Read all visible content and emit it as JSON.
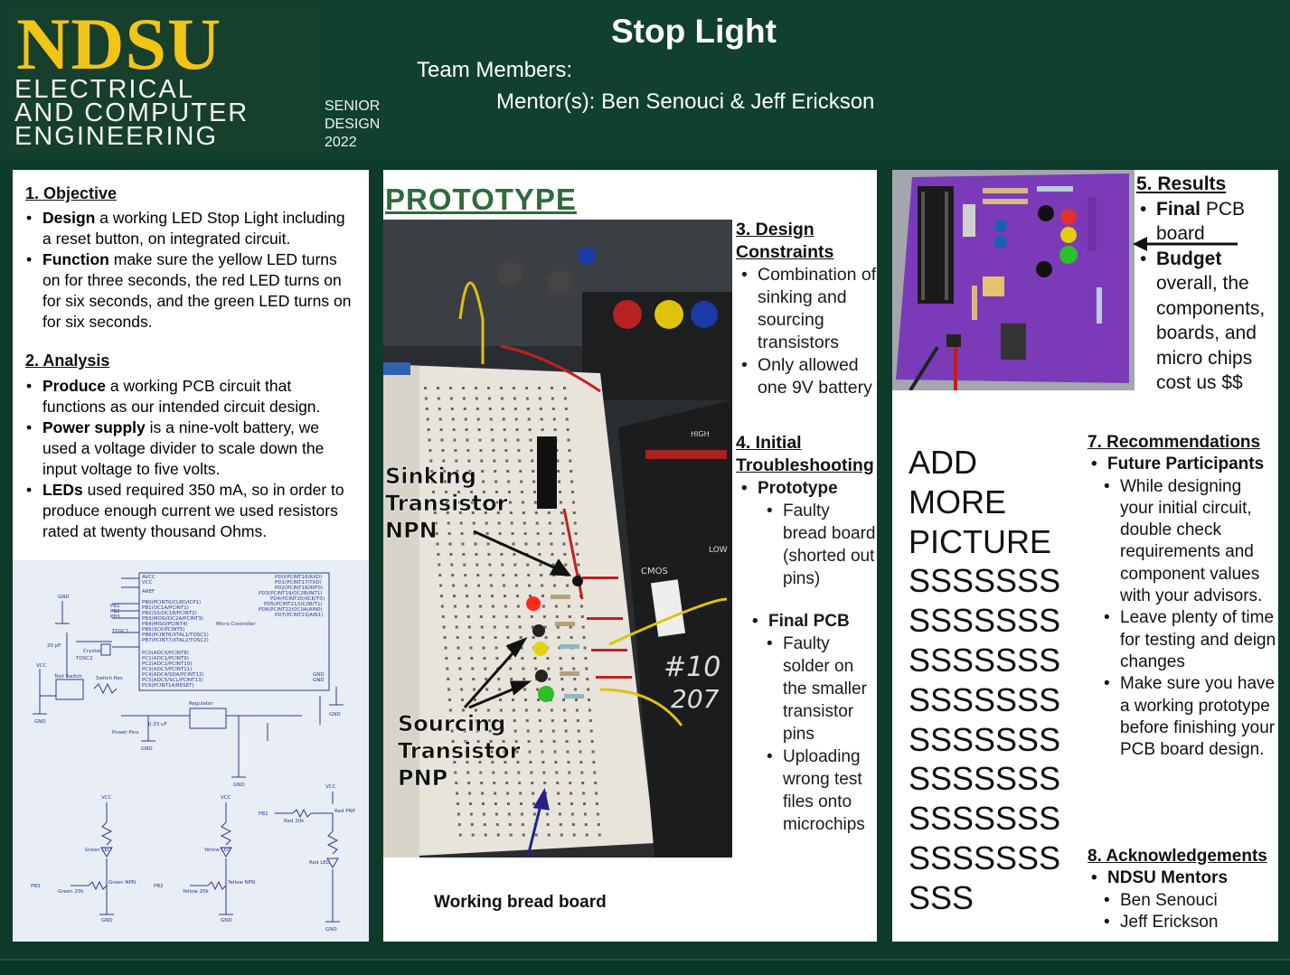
{
  "header": {
    "logo_main": "NDSU",
    "logo_line1": "ELECTRICAL",
    "logo_line2": "AND COMPUTER",
    "logo_line3": "ENGINEERING",
    "senior_line1": "SENIOR",
    "senior_line2": "DESIGN",
    "senior_line3": "2022",
    "title": "Stop Light",
    "team_label": "Team Members:",
    "mentor_label": "Mentor(s): Ben Senouci & Jeff Erickson"
  },
  "objective": {
    "title": "1. Objective",
    "items": [
      {
        "bold": "Design",
        "text": " a working LED Stop Light including a reset button, on integrated circuit."
      },
      {
        "bold": "Function",
        "text": " make sure the yellow LED turns on for three seconds, the red LED turns on for six seconds, and the green LED turns on for six seconds."
      }
    ]
  },
  "analysis": {
    "title": "2. Analysis",
    "items": [
      {
        "bold": "Produce",
        "text": " a working PCB circuit that functions as our intended circuit design."
      },
      {
        "bold": "Power supply",
        "text": " is a nine-volt battery, we used a voltage divider to scale down the input voltage to five volts."
      },
      {
        "bold": "LEDs",
        "text": " used required 350 mA, so in order to produce enough current we used resistors rated at twenty thousand Ohms."
      }
    ]
  },
  "schematic": {
    "mcu_label": "Micro Controller",
    "regulator_label": "Regulator",
    "cap_label": "0.33 uF",
    "crystal_label": "Crystal",
    "cap20_label": "20 pF",
    "switch_label": "Test Switch",
    "switch_res_label": "Switch Res",
    "power_label": "Power Pins",
    "gnd": "GND",
    "vcc": "VCC",
    "green_res": "Green 20k",
    "yellow_res": "Yellow 20k",
    "red_res": "Red 20k",
    "green_npn": "Green NPN",
    "yellow_npn": "Yellow NPN",
    "red_pnp": "Red PNP",
    "green_led": "Green LED",
    "yellow_led": "Yellow LED",
    "red_led": "Red LED",
    "pb1": "PB1",
    "pb2": "PB2",
    "pb3": "PB3"
  },
  "prototype": {
    "title": "PROTOTYPE",
    "sinking_label": "Sinking Transistor NPN",
    "sourcing_label": "Sourcing Transistor PNP",
    "caption": "Working bread board",
    "photo_text_1": "#10",
    "photo_text_2": "207",
    "photo_text_3": "CMOS",
    "photo_text_4": "LOW",
    "photo_text_5": "HIGH"
  },
  "design_constraints": {
    "title_line1": "3. Design",
    "title_line2": "Constraints",
    "items": [
      "Combination of sinking and sourcing transistors",
      "Only allowed one 9V battery"
    ]
  },
  "troubleshooting": {
    "title_line1": "4. Initial",
    "title_line2": "Troubleshooting",
    "prototype_label": "Prototype",
    "prototype_items": [
      "Faulty bread board (shorted out pins)"
    ],
    "pcb_label": "Final PCB",
    "pcb_items": [
      "Faulty solder on the smaller transistor pins",
      "Uploading wrong test files onto microchips"
    ]
  },
  "results": {
    "title": "5. Results",
    "item1_bold": "Final",
    "item1_text": " PCB board",
    "item2_bold": "Budget",
    "item2_text": " overall, the components, boards, and micro chips cost us $$"
  },
  "add_more": "ADD MORE PICTURE SSSSSSSSSSSSSSSSSSSSSSSSSSSSSSSSSSSSSSSSSSSSSSSSSSSSSSSS",
  "add_more_lines": [
    "ADD",
    "MORE",
    "PICTURE",
    "SSSSSSS",
    "SSSSSSS",
    "SSSSSSS",
    "SSSSSSS",
    "SSSSSSS",
    "SSSSSSS",
    "SSSSSSS",
    "SSSSSSS",
    "SSS"
  ],
  "recommendations": {
    "title": "7. Recommendations",
    "group_label": "Future Participants",
    "items": [
      "While designing your initial circuit, double check requirements and component values with your advisors.",
      "Leave plenty of time for testing and deign changes",
      "Make sure you have a working prototype before finishing your PCB board design."
    ]
  },
  "acknowledgements": {
    "title": "8. Acknowledgements",
    "group_label": "NDSU Mentors",
    "items": [
      "Ben Senouci",
      "Jeff Erickson"
    ]
  },
  "colors": {
    "header_bg": "#113f30",
    "logo_gold": "#f2c415",
    "prototype_green": "#2e6b3c",
    "pcb_purple": "#7b3bb8"
  }
}
